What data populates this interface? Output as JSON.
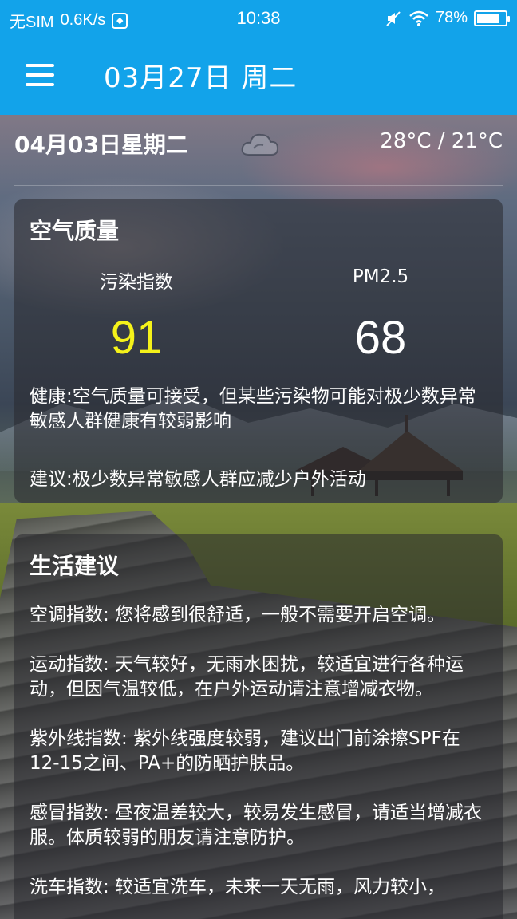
{
  "status_bar": {
    "carrier": "无SIM",
    "speed": "0.6K/s",
    "time": "10:38",
    "battery": "78%",
    "battery_level": 0.78,
    "icons": [
      "sim-icon",
      "mute-icon",
      "wifi-icon",
      "battery-icon"
    ]
  },
  "app_bar": {
    "title": "03月27日 周二",
    "menu_icon": "hamburger-menu-icon",
    "color": "#12a3ea"
  },
  "forecast": {
    "date": "04月03日星期二",
    "weather_icon": "cloud-icon",
    "temperature": "28°C / 21°C"
  },
  "air_quality": {
    "title": "空气质量",
    "pollution_label": "污染指数",
    "pollution_value": "91",
    "pollution_color": "#f5f21a",
    "pm25_label": "PM2.5",
    "pm25_value": "68",
    "health": "健康:空气质量可接受，但某些污染物可能对极少数异常敏感人群健康有较弱影响",
    "advice": "建议:极少数异常敏感人群应减少户外活动"
  },
  "life_tips": {
    "title": "生活建议",
    "items": [
      "空调指数: 您将感到很舒适，一般不需要开启空调。",
      "运动指数: 天气较好，无雨水困扰，较适宜进行各种运动，但因气温较低，在户外运动请注意增减衣物。",
      "紫外线指数: 紫外线强度较弱，建议出门前涂擦SPF在12-15之间、PA+的防晒护肤品。",
      "感冒指数: 昼夜温差较大，较易发生感冒，请适当增减衣服。体质较弱的朋友请注意防护。",
      "洗车指数: 较适宜洗车，未来一天无雨，风力较小，"
    ]
  }
}
